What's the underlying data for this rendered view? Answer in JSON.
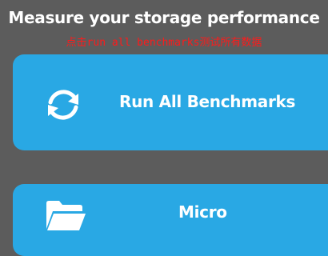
{
  "header": {
    "title": "Measure your storage performance",
    "annotation": "点击run all benchmarks测试所有数据"
  },
  "cards": [
    {
      "label": "Run All Benchmarks",
      "icon": "refresh-icon"
    },
    {
      "label": "Micro",
      "icon": "folder-icon"
    }
  ],
  "colors": {
    "background": "#5c5c5c",
    "card": "#29a8e4",
    "annotation": "#ff1a1a"
  }
}
